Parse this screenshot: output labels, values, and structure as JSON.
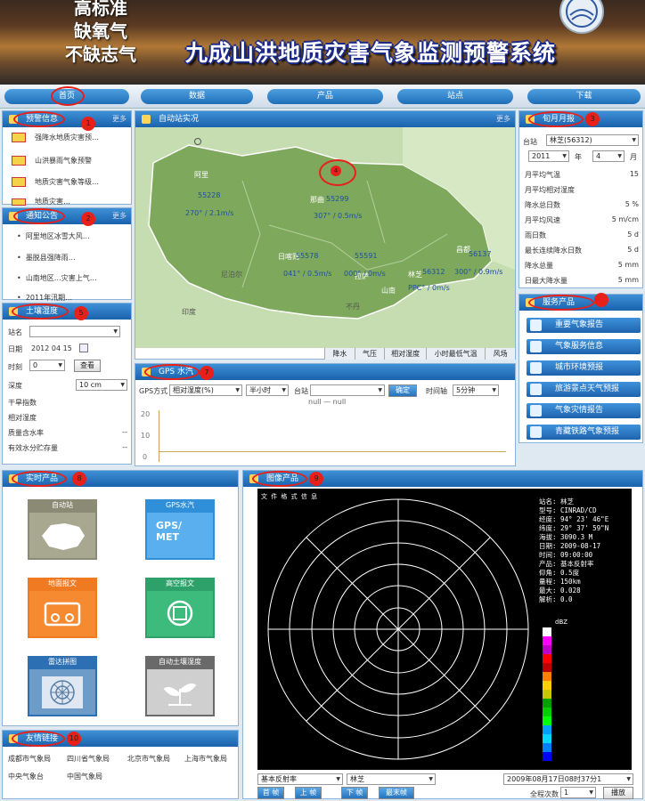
{
  "banner": {
    "slogan_lines": [
      "高标准",
      "缺氧气",
      "不缺志气"
    ],
    "title": "九成山洪地质灾害气象监测预警系统"
  },
  "nav": [
    "首页",
    "数据",
    "产品",
    "站点",
    "下载"
  ],
  "warning": {
    "title": "预警信息",
    "more": "更多",
    "badge": "1",
    "items": [
      "强降水地质灾害预…",
      "山洪暴雨气象预警",
      "地质灾害气象等级…",
      "地质灾害…"
    ]
  },
  "notice": {
    "title": "通知公告",
    "more": "更多",
    "badge": "2",
    "items": [
      "阿里地区冰雪大风…",
      "墨脱县强降雨…",
      "山南地区…灾害上气…",
      "2011年汛期…"
    ]
  },
  "soil": {
    "title": "土壤湿度",
    "badge": "5",
    "station_label": "站名",
    "date_label": "日期",
    "date_value": "2012 04 15",
    "time_label": "时刻",
    "time_value": "0",
    "query": "查看",
    "depth_label": "深度",
    "depth_value": "10 cm",
    "rows": [
      {
        "k": "干旱指数",
        "v": ""
      },
      {
        "k": "相对湿度",
        "v": ""
      },
      {
        "k": "质量含水率",
        "v": "--"
      },
      {
        "k": "有效水分贮存量",
        "v": "--"
      }
    ]
  },
  "map": {
    "title": "自动站实况",
    "more": "更多",
    "badge": "4",
    "regions": [
      "阿里",
      "那曲",
      "昌都",
      "日喀则",
      "拉萨",
      "林芝",
      "山南",
      "印度",
      "不丹",
      "尼泊尔"
    ],
    "stations": [
      {
        "id": "55228",
        "wind": "270° / 2.1m/s"
      },
      {
        "id": "55299",
        "wind": "307° / 0.5m/s"
      },
      {
        "id": "55578",
        "wind": "041° / 0.5m/s"
      },
      {
        "id": "55591",
        "wind": "000° / 0m/s"
      },
      {
        "id": "56312",
        "wind": "PPC° / 0m/s"
      },
      {
        "id": "56137",
        "wind": "300° / 0.9m/s"
      }
    ],
    "tabs": [
      "降水",
      "气压",
      "相对湿度",
      "小时最低气温",
      "风场"
    ]
  },
  "gps": {
    "title": "GPS 水汽",
    "badge": "7",
    "type_label": "GPS方式",
    "type_value": "相对湿度(%)",
    "period_value": "半小时",
    "station_label": "台站",
    "confirm": "确定",
    "interval_label": "时间轴",
    "interval_value": "5分钟",
    "legend": "null — null",
    "y_ticks": [
      "20",
      "10",
      "0"
    ]
  },
  "monthly": {
    "title": "旬月月报",
    "badge": "3",
    "station_label": "台站",
    "station_value": "林芝(56312)",
    "year": "2011",
    "year_unit": "年",
    "month": "4",
    "month_unit": "月",
    "rows": [
      {
        "k": "月平均气温",
        "v": "15"
      },
      {
        "k": "月平均相对湿度",
        "v": ""
      },
      {
        "k": "降水总日数",
        "v": "5 %"
      },
      {
        "k": "月平均风速",
        "v": "5 m/cm"
      },
      {
        "k": "雨日数",
        "v": "5 d"
      },
      {
        "k": "最长连续降水日数",
        "v": "5 d"
      },
      {
        "k": "降水总量",
        "v": "5 mm"
      },
      {
        "k": "日最大降水量",
        "v": "5 mm"
      }
    ]
  },
  "service": {
    "title": "服务产品",
    "badge": "",
    "items": [
      "重要气象报告",
      "气象服务信息",
      "城市环境预报",
      "旅游景点天气预报",
      "气象灾情报告",
      "青藏铁路气象预报"
    ]
  },
  "realtime": {
    "title": "实时产品",
    "badge": "8",
    "tiles": [
      {
        "label": "自动站",
        "color": "#8b8b75",
        "sub": ""
      },
      {
        "label": "GPS水汽",
        "color": "#2f8fd8",
        "sub": "GPS/ MET"
      },
      {
        "label": "地面报文",
        "color": "#ef7a22",
        "sub": ""
      },
      {
        "label": "高空报文",
        "color": "#2ea06a",
        "sub": ""
      },
      {
        "label": "雷达拼图",
        "color": "#2c6fb2",
        "sub": ""
      },
      {
        "label": "自动土壤湿度",
        "color": "#6a6a6a",
        "sub": ""
      }
    ]
  },
  "links": {
    "title": "友情链接",
    "badge": "10",
    "items": [
      "成都市气象局",
      "四川省气象局",
      "北京市气象局",
      "上海市气象局",
      "中央气象台",
      "中国气象局"
    ]
  },
  "radar": {
    "title": "图像产品",
    "badge": "9",
    "header": "文 件 格 式 信 息",
    "info": [
      "站名: 林芝",
      "型号: CINRAD/CD",
      "经度: 94° 23' 46\"E",
      "纬度: 29° 37' 59\"N",
      "海拔: 3090.3 M",
      "日期: 2009-08-17",
      "时间: 09:00:00",
      "产品: 基本反射率",
      "仰角: 0.5度",
      "量程: 150km",
      "最大: 0.028",
      "解析: 0.0"
    ],
    "unit": "dBZ",
    "scale_colors": [
      "#ffffff",
      "#ff00ff",
      "#c000c0",
      "#ff0000",
      "#c00000",
      "#ff8000",
      "#ffd000",
      "#c8c800",
      "#00a000",
      "#00d000",
      "#00ff00",
      "#00a0ff",
      "#00d8ff",
      "#0080ff",
      "#0000ff"
    ],
    "product_value": "基本反射率",
    "station_value": "林芝",
    "time_value": "2009年08月17日08时37分1",
    "buttons": [
      "首 帧",
      "上 帧",
      "下 帧",
      "最末帧"
    ],
    "loop_label": "全程次数",
    "loop_value": "1",
    "play": "播放"
  }
}
